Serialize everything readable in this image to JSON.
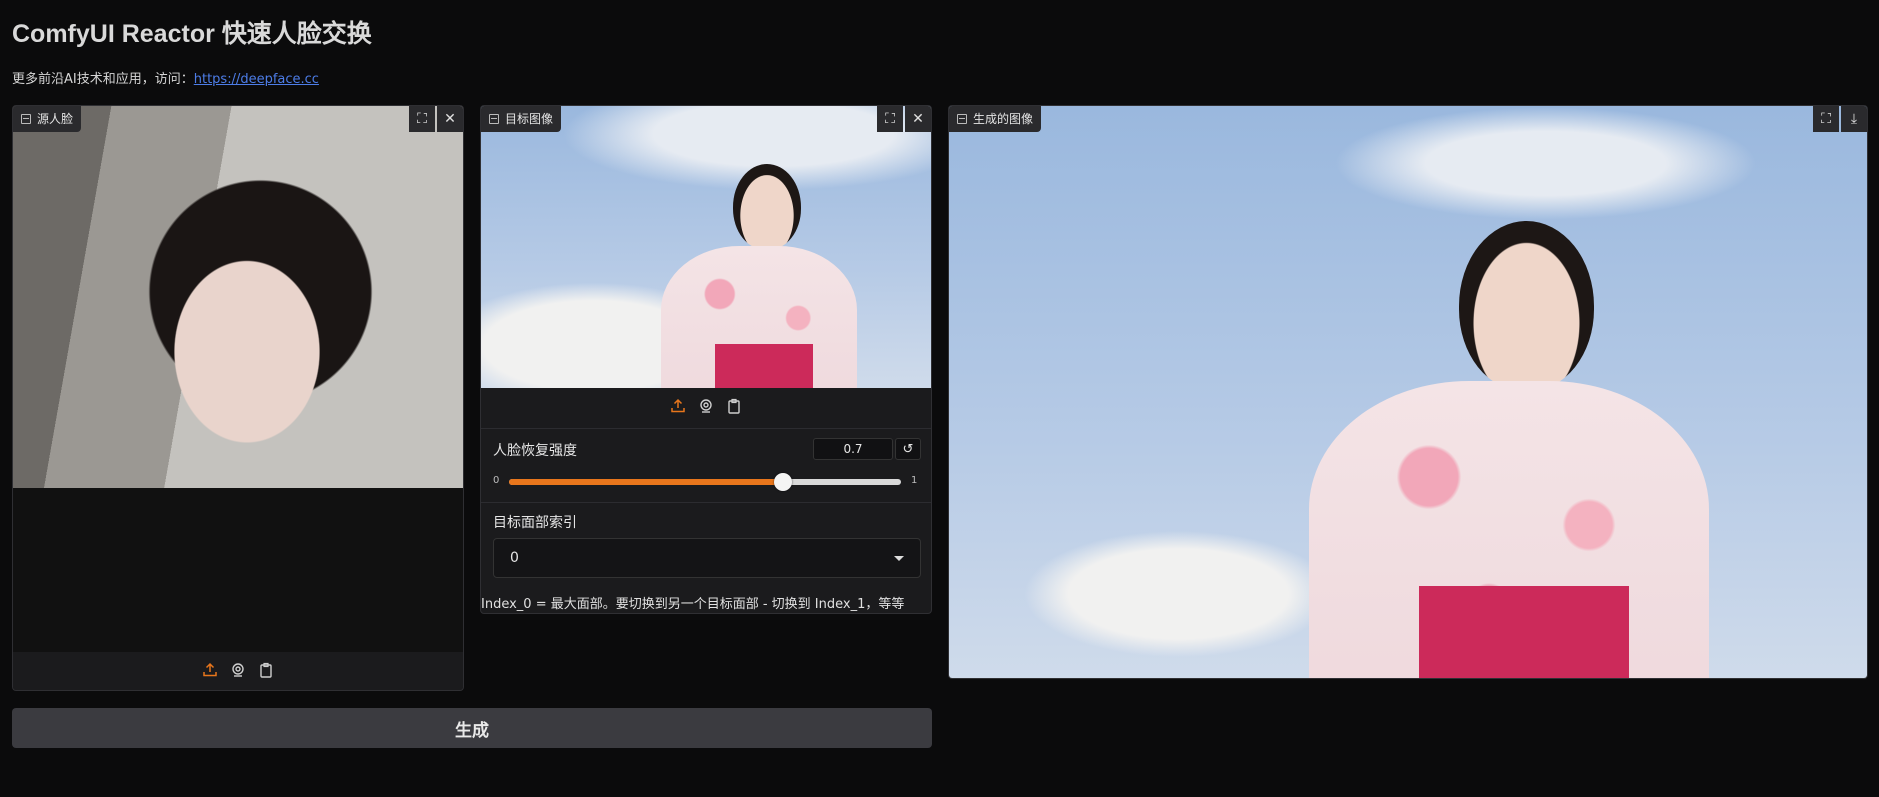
{
  "header": {
    "title": "ComfyUI Reactor 快速人脸交换",
    "subtitle_prefix": "更多前沿AI技术和应用，访问：",
    "subtitle_link": "https://deepface.cc"
  },
  "source_panel": {
    "label": "源人脸",
    "fullscreen_icon": "⛶",
    "close_icon": "✕"
  },
  "target_panel": {
    "label": "目标图像",
    "fullscreen_icon": "⛶",
    "close_icon": "✕"
  },
  "output_panel": {
    "label": "生成的图像",
    "fullscreen_icon": "⛶",
    "download_icon": "⤓"
  },
  "controls": {
    "restore_strength": {
      "label": "人脸恢复强度",
      "value": "0.7",
      "reset_icon": "↺",
      "min_label": "0",
      "max_label": "1",
      "fill_fraction": 0.7
    },
    "face_index": {
      "label": "目标面部索引",
      "selected": "0",
      "info": "Index_0 = 最大面部。要切换到另一个目标面部 - 切换到 Index_1，等等"
    }
  },
  "generate_button": {
    "label": "生成"
  },
  "colors": {
    "accent": "#e8761c",
    "background": "#0b0b0c",
    "panel": "#1b1b1d",
    "link": "#4d7de8"
  }
}
